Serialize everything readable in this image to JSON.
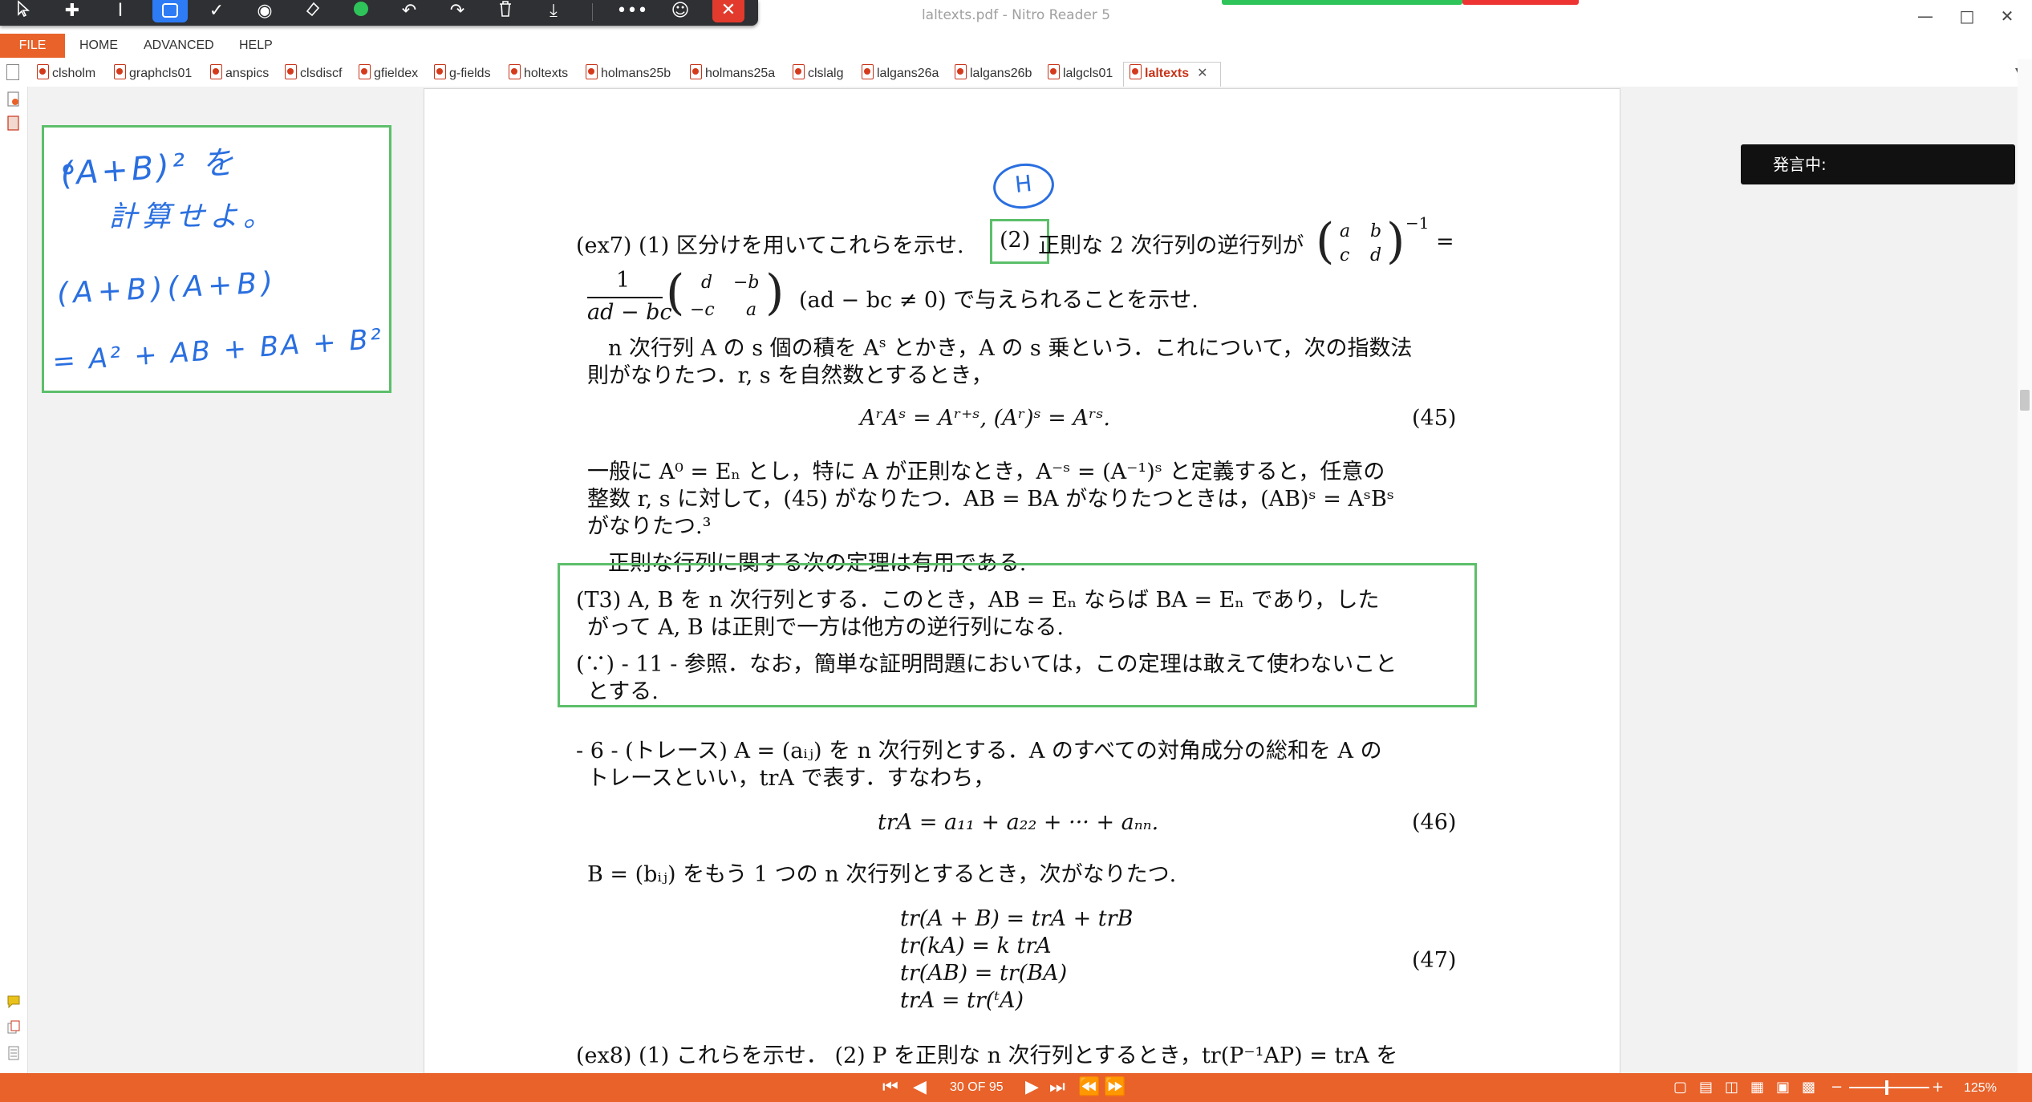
{
  "app": {
    "title": "laltexts.pdf - Nitro Reader 5",
    "window_controls": [
      "minimize-icon",
      "maximize-icon",
      "close-icon"
    ]
  },
  "colors": {
    "accent": "#e8622a",
    "annotation_green": "#5cbf6a",
    "handwriting_blue": "#2a6fe0",
    "pen_toolbar": "#2f3033",
    "pen_active": "#2d7cf6"
  },
  "pen_toolbar": {
    "tools": [
      "select-arrow-icon",
      "move-icon",
      "text-cursor-icon",
      "rectangle-icon",
      "checkmark-icon",
      "stamp-icon",
      "eraser-icon",
      "green-color-icon",
      "undo-icon",
      "redo-icon",
      "trash-icon",
      "download-icon",
      "more-icon",
      "person-icon",
      "close-icon"
    ]
  },
  "menu": {
    "file": "FILE",
    "home": "HOME",
    "advanced": "ADVANCED",
    "help": "HELP"
  },
  "tabs": [
    "clsholm",
    "graphcls01",
    "anspics",
    "clsdiscf",
    "gfieldex",
    "g-fields",
    "holtexts",
    "holmans25b",
    "holmans25a",
    "clslalg",
    "lalgans26a",
    "lalgans26b",
    "lalgcls01",
    "laltexts"
  ],
  "active_tab": "laltexts",
  "sticky_note": {
    "lines": [
      "(A+B)² を",
      "計算せよ。",
      "(A+B)(A+B)",
      "= A² + AB + BA + B²"
    ]
  },
  "speaking_popup": "発言中:",
  "document": {
    "h_mark": "H",
    "ex7_line1_a": "(ex7) (1) 区分けを用いてこれらを示せ.",
    "ex7_line1_b": "(2)",
    "ex7_line1_c": "正則な 2 次行列の逆行列が",
    "matrix1": [
      "a",
      "b",
      "c",
      "d"
    ],
    "matrix1_exp": "−1",
    "equals": "=",
    "frac_num": "1",
    "frac_den": "ad − bc",
    "matrix2": [
      "d",
      "−b",
      "−c",
      "a"
    ],
    "ex7_line2_rest": "(ad − bc ≠ 0) で与えられることを示せ.",
    "para1_line1": "n 次行列 A の s 個の積を A",
    "para1_line1_sup": "s",
    "para1_line1_rest": " とかき，A の s 乗という．これについて，次の指数法",
    "para1_line2": "則がなりたつ．r, s を自然数とするとき，",
    "eq45": "AʳAˢ = Aʳ⁺ˢ,        (Aʳ)ˢ = Aʳˢ.",
    "eq45_no": "(45)",
    "para2_line1": "一般に A⁰ = Eₙ とし，特に A が正則なとき，A⁻ˢ = (A⁻¹)ˢ と定義すると，任意の",
    "para2_line2": "整数 r, s に対して，(45) がなりたつ．AB = BA がなりたつときは，(AB)ˢ = AˢBˢ",
    "para2_line3": "がなりたつ.³",
    "para3": "正則な行列に関する次の定理は有用である.",
    "t3_line1": "(T3) A, B を n 次行列とする．このとき，AB = Eₙ ならば BA = Eₙ であり，した",
    "t3_line2": "がって A, B は正則で一方は他方の逆行列になる.",
    "t3_line3": "(∵) - 11 - 参照．なお，簡単な証明問題においては，この定理は敢えて使わないこと",
    "t3_line4": "とする.",
    "s6_line1": "- 6 - (トレース) A = (aᵢⱼ) を n 次行列とする．A のすべての対角成分の総和を A の",
    "s6_line2": "トレースといい，trA で表す．すなわち，",
    "eq46": "trA = a₁₁ + a₂₂ + ··· + aₙₙ.",
    "eq46_no": "(46)",
    "para4": "B = (bᵢⱼ) をもう 1 つの n 次行列とするとき，次がなりたつ.",
    "eq47_lines": [
      "tr(A + B) = trA + trB",
      "tr(kA) = k trA",
      "tr(AB) = tr(BA)",
      "trA = tr(ᵗA)"
    ],
    "eq47_no": "(47)",
    "ex8_line1": "(ex8) (1) これらを示せ．  (2) P を正則な n 次行列とするとき，tr(P⁻¹AP) = trA を"
  },
  "statusbar": {
    "page_indicator": "30 OF 95",
    "zoom": "125%",
    "zoom_fraction": 0.45
  }
}
